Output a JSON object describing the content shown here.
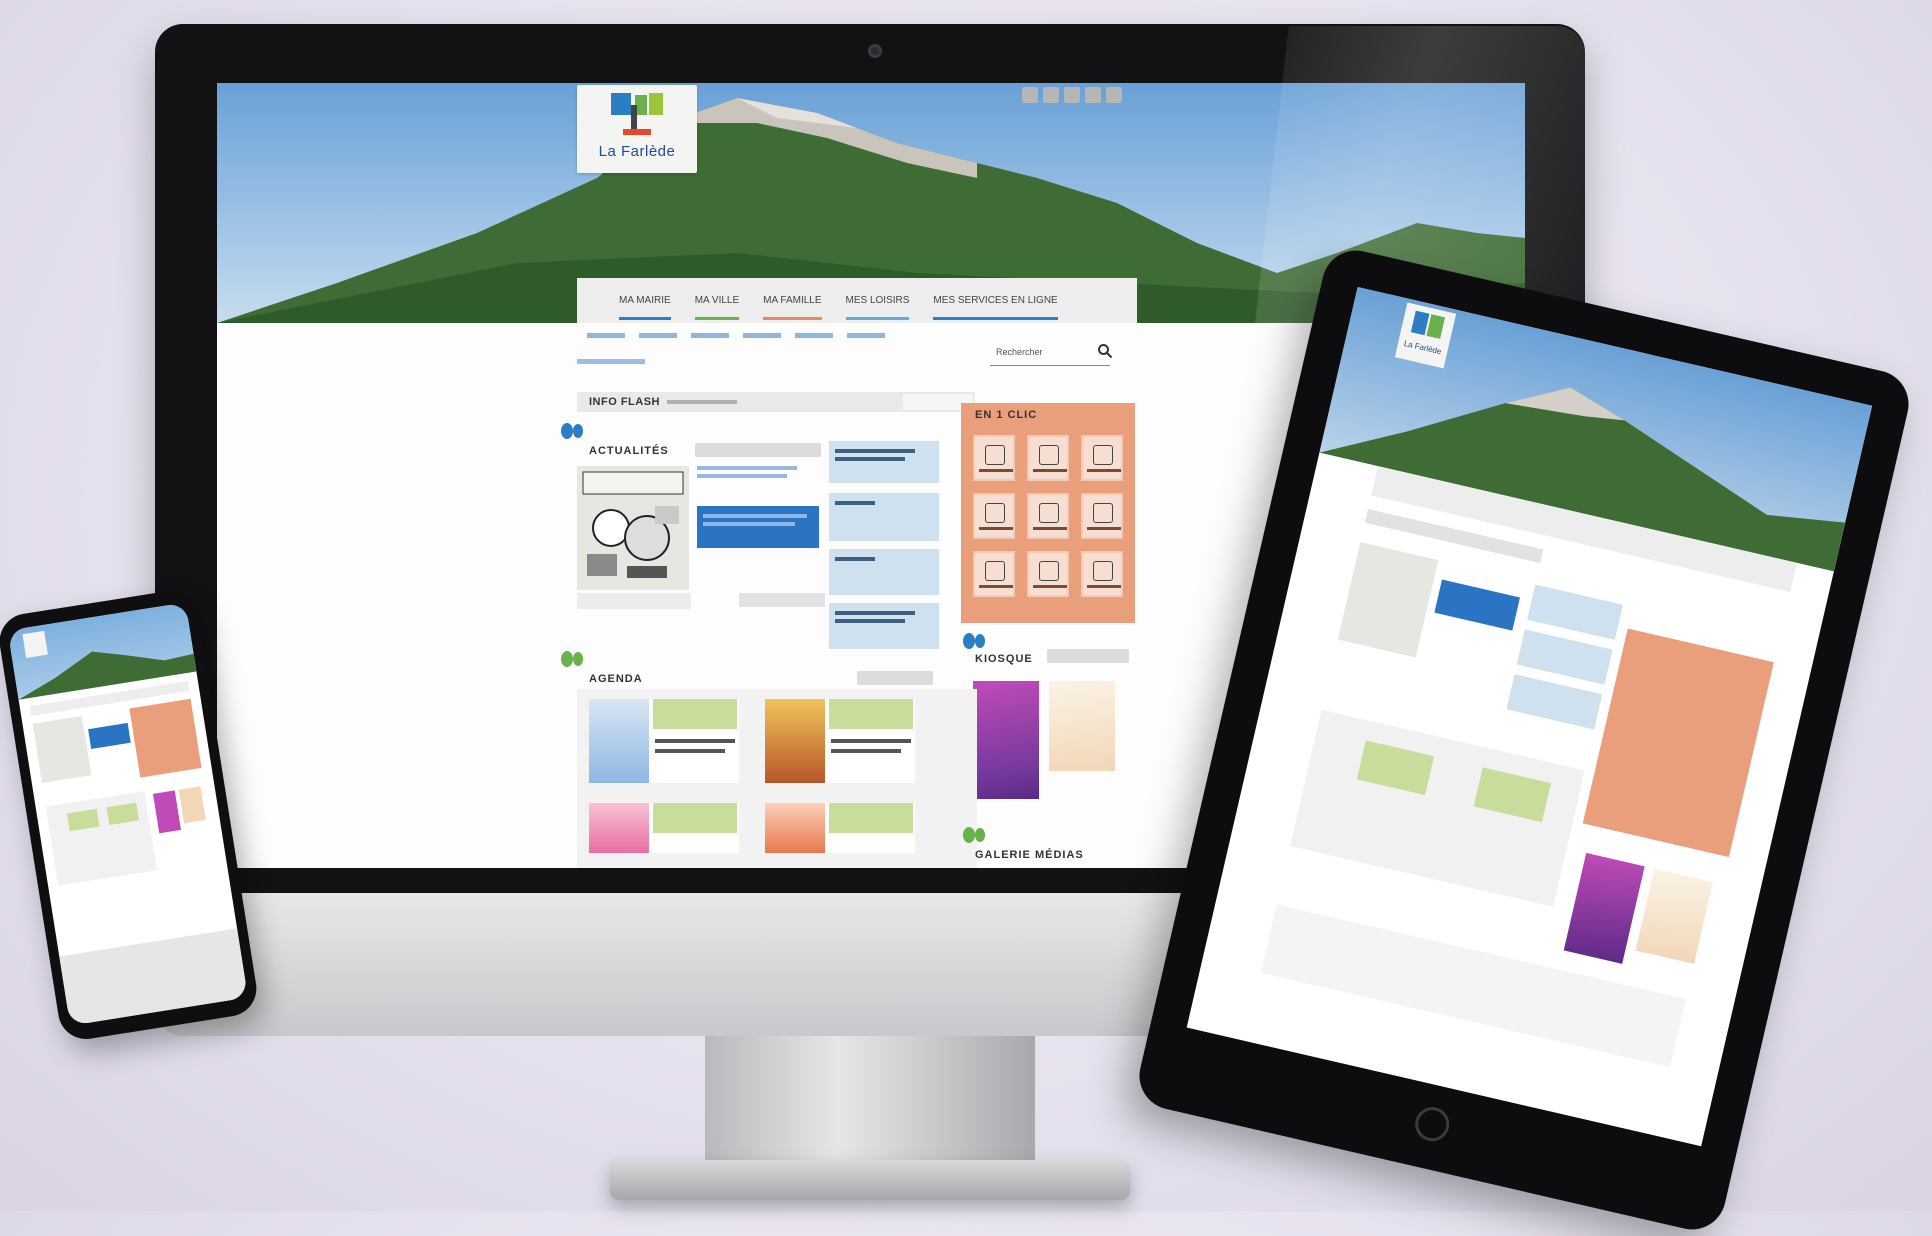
{
  "site": {
    "logo_text": "La Farlède",
    "nav_items": [
      "MA MAIRIE",
      "MA VILLE",
      "MA FAMILLE",
      "MES LOISIRS",
      "MES SERVICES EN LIGNE"
    ],
    "search_placeholder": "Rechercher",
    "info_flash": {
      "label": "INFO FLASH"
    },
    "sections": {
      "actualites": "ACTUALITÉS",
      "en_1_clic": "EN 1 CLIC",
      "kiosque": "KIOSQUE",
      "agenda": "AGENDA",
      "galerie": "GALERIE MÉDIAS"
    }
  },
  "colors": {
    "nav_blue": "#2c7ec4",
    "highlight_blue": "#2b74c3",
    "clic_orange": "#e99f7c",
    "agenda_green": "#c8dd9b"
  },
  "icons": [
    "search-icon",
    "leaf-icon",
    "facebook-icon",
    "twitter-icon",
    "youtube-icon",
    "instagram-icon",
    "rss-icon"
  ]
}
